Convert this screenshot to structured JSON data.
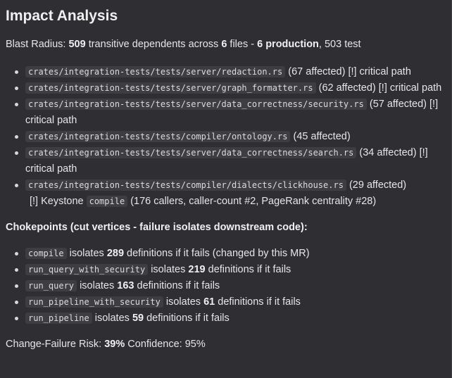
{
  "title": "Impact Analysis",
  "blast": {
    "label": "Blast Radius:",
    "count": "509",
    "text_a": "transitive dependents across",
    "files_count": "6",
    "text_b": "files -",
    "production": "6 production",
    "text_c": ", 503 test"
  },
  "files": [
    {
      "path": "crates/integration-tests/tests/server/redaction.rs",
      "detail": "(67 affected) [!] critical path"
    },
    {
      "path": "crates/integration-tests/tests/server/graph_formatter.rs",
      "detail": "(62 affected) [!] critical path"
    },
    {
      "path": "crates/integration-tests/tests/server/data_correctness/security.rs",
      "detail": "(57 affected) [!] critical path"
    },
    {
      "path": "crates/integration-tests/tests/compiler/ontology.rs",
      "detail": "(45 affected)"
    },
    {
      "path": "crates/integration-tests/tests/server/data_correctness/search.rs",
      "detail": "(34 affected) [!] critical path"
    },
    {
      "path": "crates/integration-tests/tests/compiler/dialects/clickhouse.rs",
      "detail": "(29 affected)",
      "keystone_prefix": "[!] Keystone",
      "keystone_code": "compile",
      "keystone_suffix": "(176 callers, caller-count #2, PageRank centrality #28)"
    }
  ],
  "chokepoints_title": "Chokepoints (cut vertices - failure isolates downstream code):",
  "chokepoints": [
    {
      "name": "compile",
      "pre": "isolates",
      "count": "289",
      "post": "definitions if it fails (changed by this MR)"
    },
    {
      "name": "run_query_with_security",
      "pre": "isolates",
      "count": "219",
      "post": "definitions if it fails"
    },
    {
      "name": "run_query",
      "pre": "isolates",
      "count": "163",
      "post": "definitions if it fails"
    },
    {
      "name": "run_pipeline_with_security",
      "pre": "isolates",
      "count": "61",
      "post": "definitions if it fails"
    },
    {
      "name": "run_pipeline",
      "pre": "isolates",
      "count": "59",
      "post": "definitions if it fails"
    }
  ],
  "risk": {
    "label": "Change-Failure Risk:",
    "value": "39%",
    "confidence_label": "Confidence:",
    "confidence_value": "95%"
  }
}
